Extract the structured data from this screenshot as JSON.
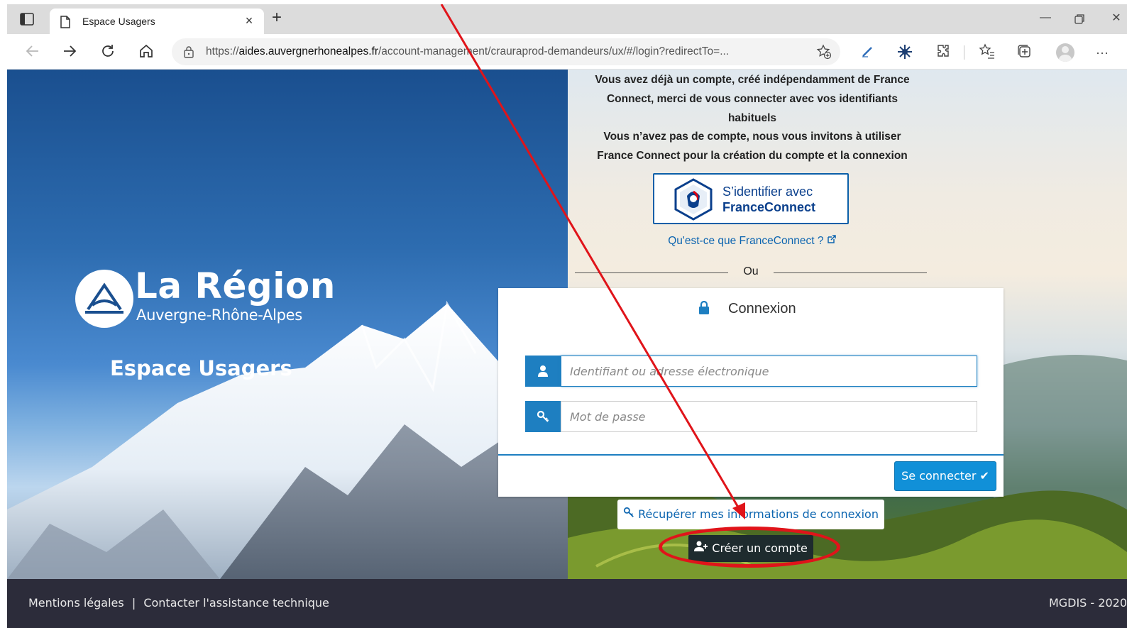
{
  "browser": {
    "tab_title": "Espace Usagers",
    "tab_close": "×",
    "new_tab": "+",
    "win_min": "—",
    "win_close": "✕",
    "url_scheme": "https://",
    "url_host": "aides.auvergnerhonealpes.fr",
    "url_path": "/account-management/crauraprod-demandeurs/ux/#/login?redirectTo=...",
    "more_menu": "···"
  },
  "hero": {
    "brand_name": "La Région",
    "brand_sub": "Auvergne-Rhône-Alpes",
    "space_title": "Espace Usagers"
  },
  "intro": {
    "line1": "Vous avez déjà un compte, créé indépendamment de France",
    "line2": "Connect, merci de vous connecter avec vos identifiants",
    "line3": "habituels",
    "line4": "Vous n’avez pas de compte, nous vous invitons à utiliser",
    "line5": "France Connect pour la création du compte et la connexion"
  },
  "franceconnect": {
    "line1": "S’identifier avec",
    "line2": "FranceConnect",
    "info_link": "Qu'est-ce que FranceConnect ?"
  },
  "separator_text": "Ou",
  "login": {
    "title": "Connexion",
    "username_placeholder": "Identifiant ou adresse électronique",
    "password_placeholder": "Mot de passe",
    "submit_label": "Se connecter ✔"
  },
  "recover_label": "Récupérer mes informations de connexion",
  "create_label": "Créer un compte",
  "footer": {
    "legal": "Mentions légales",
    "separator": "|",
    "support": "Contacter l'assistance technique",
    "copyright": "MGDIS - 2020"
  },
  "colors": {
    "brand_blue": "#1e7fc1",
    "link_blue": "#0c65b0",
    "annotation_red": "#e0141a",
    "footer_bg": "#2c2c3a"
  }
}
